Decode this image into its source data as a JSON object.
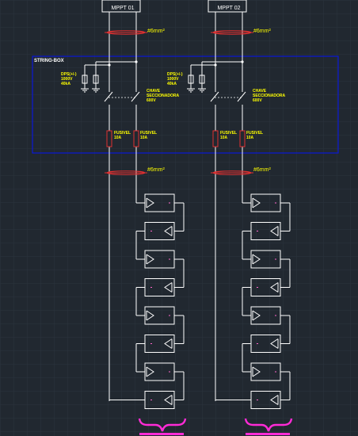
{
  "colors": {
    "background": "#212830",
    "grid": "#2c343e",
    "wire": "#ffffff",
    "box": "#0a18d8",
    "label": "#ffff00",
    "cable": "#e03030",
    "brace": "#ff2bd6",
    "module_mark": "#ff66cc"
  },
  "string_box": {
    "title": "STRING-BOX"
  },
  "strings": [
    {
      "mppt_label": "MPPT 01",
      "cable_top": "#6mm²",
      "cable_bottom": "#6mm²",
      "dps_label": [
        "DPS(+/-)",
        "1000V",
        "40kA"
      ],
      "switch_label": [
        "CHAVE",
        "SECCIONADORA",
        "600V"
      ],
      "fuse_left": [
        "FUSIVEL",
        "10A"
      ],
      "fuse_right": [
        "FUSIVEL",
        "10A"
      ],
      "module_count": 8
    },
    {
      "mppt_label": "MPPT 02",
      "cable_top": "#6mm²",
      "cable_bottom": "#6mm²",
      "dps_label": [
        "DPS(+/-)",
        "1000V",
        "40kA"
      ],
      "switch_label": [
        "CHAVE",
        "SECCIONADORA",
        "600V"
      ],
      "fuse_left": [
        "FUSIVEL",
        "10A"
      ],
      "fuse_right": [
        "FUSIVEL",
        "10A"
      ],
      "module_count": 8
    }
  ]
}
